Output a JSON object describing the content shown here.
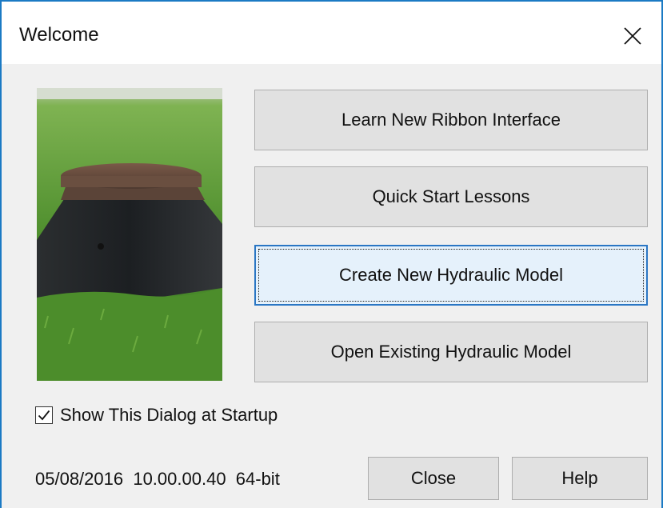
{
  "window": {
    "title": "Welcome"
  },
  "buttons": {
    "learn_ribbon": "Learn New Ribbon Interface",
    "quick_start": "Quick Start Lessons",
    "create_model": "Create New Hydraulic Model",
    "open_model": "Open Existing Hydraulic Model",
    "close": "Close",
    "help": "Help"
  },
  "startup_checkbox": {
    "label": "Show This Dialog at Startup",
    "checked": true
  },
  "footer": {
    "version_info": "05/08/2016  10.00.00.40  64-bit"
  },
  "icons": {
    "close": "close-icon",
    "check": "checkmark-icon"
  },
  "colors": {
    "window_border": "#1b7ac4",
    "focus_border": "#2a76c4",
    "button_face": "#e1e1e1",
    "dialog_bg": "#f0f0f0"
  }
}
